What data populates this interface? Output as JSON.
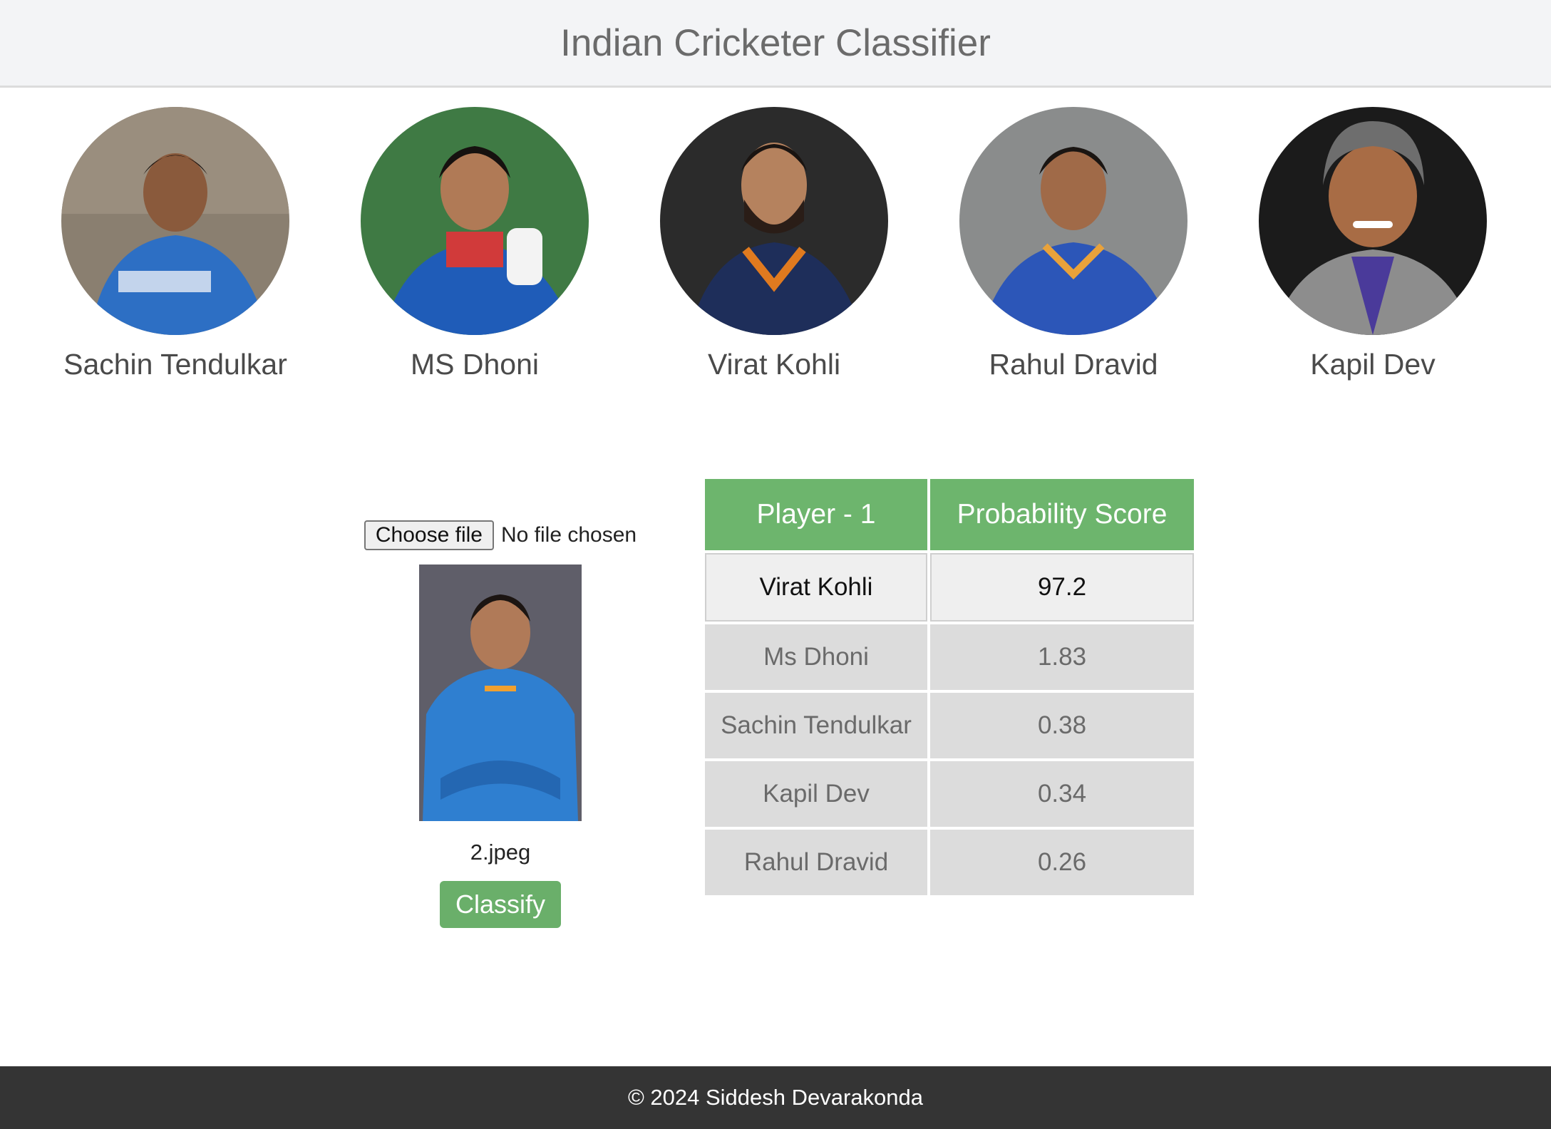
{
  "header": {
    "title": "Indian Cricketer Classifier"
  },
  "players": [
    {
      "name": "Sachin Tendulkar",
      "bg": "#8a7f70"
    },
    {
      "name": "MS Dhoni",
      "bg": "#3f7a44"
    },
    {
      "name": "Virat Kohli",
      "bg": "#2b2b2b"
    },
    {
      "name": "Rahul Dravid",
      "bg": "#8a8c8c"
    },
    {
      "name": "Kapil Dev",
      "bg": "#1b1b1b"
    }
  ],
  "upload": {
    "button_label": "Choose file",
    "status": "No file chosen",
    "file_name": "2.jpeg",
    "classify_label": "Classify"
  },
  "results": {
    "headers": [
      "Player - 1",
      "Probability Score"
    ],
    "rows": [
      {
        "player": "Virat Kohli",
        "score": "97.2"
      },
      {
        "player": "Ms Dhoni",
        "score": "1.83"
      },
      {
        "player": "Sachin Tendulkar",
        "score": "0.38"
      },
      {
        "player": "Kapil Dev",
        "score": "0.34"
      },
      {
        "player": "Rahul Dravid",
        "score": "0.26"
      }
    ]
  },
  "footer": {
    "text": "© 2024 Siddesh Devarakonda"
  },
  "colors": {
    "accent": "#6db56d",
    "header_bg": "#f3f4f6",
    "footer_bg": "#343434"
  }
}
